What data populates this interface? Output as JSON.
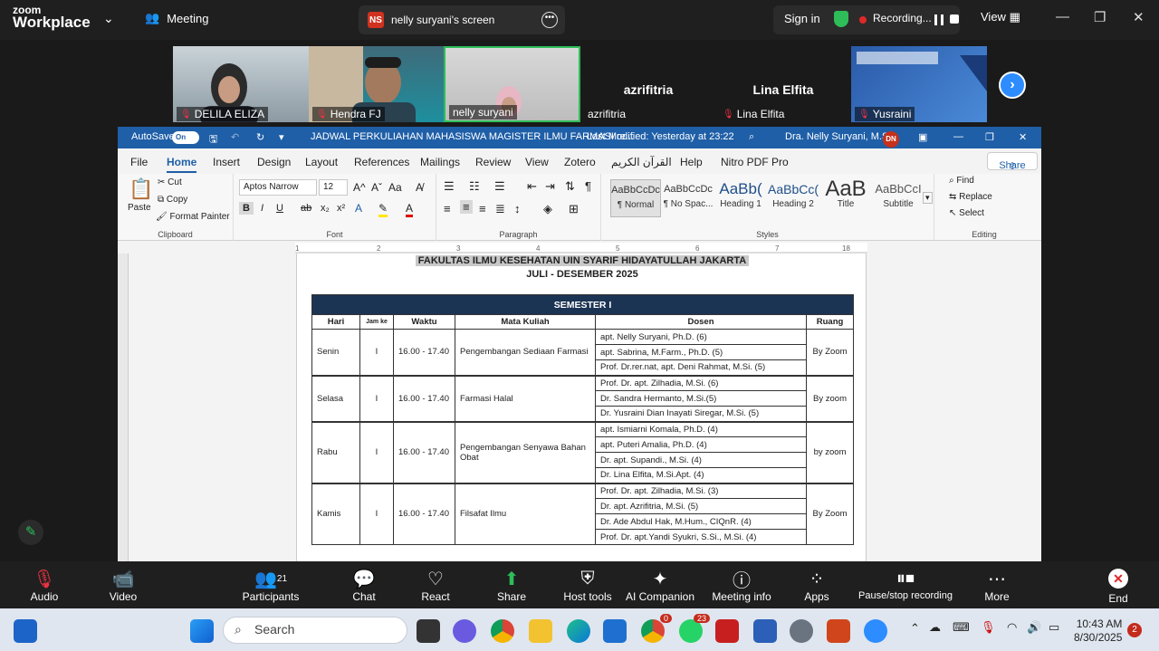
{
  "topbar": {
    "logo_small": "zoom",
    "logo_big": "Workplace",
    "meeting_label": "Meeting",
    "screen_badge": "NS",
    "screen_label": "nelly suryani's screen",
    "signin": "Sign in",
    "recording": "Recording...",
    "view": "View"
  },
  "thumbnails": [
    {
      "name": "DELILA ELIZA"
    },
    {
      "name": "Hendra FJ"
    },
    {
      "name": "nelly suryani"
    },
    {
      "name": "azrifitria",
      "big": "azrifitria"
    },
    {
      "name": "Lina Elfita",
      "big": "Lina Elfita"
    },
    {
      "name": "Yusraini"
    }
  ],
  "word": {
    "autosave": "AutoSave",
    "autosave_state": "On",
    "doc_title": "JADWAL PERKULIAHAN MAHASISWA MAGISTER ILMU FARMASI re...",
    "modified": "Last Modified: Yesterday at 23:22",
    "user": "Dra. Nelly Suryani, M.Si.",
    "avatar": "DN",
    "tabs": [
      "File",
      "Home",
      "Insert",
      "Design",
      "Layout",
      "References",
      "Mailings",
      "Review",
      "View",
      "Zotero",
      "القرآن الكريم",
      "Help",
      "Nitro PDF Pro"
    ],
    "share": "Share",
    "clipboard": {
      "paste": "Paste",
      "cut": "Cut",
      "copy": "Copy",
      "painter": "Format Painter",
      "label": "Clipboard"
    },
    "font": {
      "name": "Aptos Narrow",
      "size": "12",
      "label": "Font"
    },
    "paragraph_label": "Paragraph",
    "styles": [
      {
        "preview": "AaBbCcDc",
        "label": "¶ Normal"
      },
      {
        "preview": "AaBbCcDc",
        "label": "¶ No Spac..."
      },
      {
        "preview": "AaBb(",
        "label": "Heading 1"
      },
      {
        "preview": "AaBbCc(",
        "label": "Heading 2"
      },
      {
        "preview": "AaB",
        "label": "Title"
      },
      {
        "preview": "AaBbCcI",
        "label": "Subtitle"
      }
    ],
    "styles_label": "Styles",
    "editing": {
      "find": "Find",
      "replace": "Replace",
      "select": "Select",
      "label": "Editing"
    }
  },
  "document": {
    "header1": "FAKULTAS ILMU KESEHATAN UIN SYARIF HIDAYATULLAH JAKARTA",
    "header2": "JULI - DESEMBER  2025",
    "semester": "SEMESTER I",
    "columns": [
      "Hari",
      "Jam ke",
      "Waktu",
      "Mata Kuliah",
      "Dosen",
      "Ruang"
    ],
    "rows": [
      {
        "hari": "Senin",
        "jam": "I",
        "waktu": "16.00 - 17.40",
        "mk": "Pengembangan Sediaan Farmasi",
        "ruang": "By Zoom",
        "dosen": [
          "apt. Nelly Suryani, Ph.D. (6)",
          "apt. Sabrina, M.Farm., Ph.D. (5)",
          "Prof. Dr.rer.nat, apt. Deni Rahmat, M.Si. (5)"
        ]
      },
      {
        "hari": "Selasa",
        "jam": "I",
        "waktu": "16.00 - 17.40",
        "mk": "Farmasi Halal",
        "ruang": "By zoom",
        "dosen": [
          "Prof. Dr. apt. Zilhadia, M.Si. (6)",
          "Dr. Sandra Hermanto, M.Si.(5)",
          "Dr. Yusraini Dian Inayati Siregar, M.Si. (5)"
        ]
      },
      {
        "hari": "Rabu",
        "jam": "I",
        "waktu": "16.00 - 17.40",
        "mk": "Pengembangan Senyawa Bahan Obat",
        "ruang": "by zoom",
        "dosen": [
          "apt. Ismiarni Komala, Ph.D. (4)",
          "apt. Puteri Amalia, Ph.D. (4)",
          "Dr. apt. Supandi., M.Si. (4)",
          "Dr. Lina Elfita, M.Si.Apt. (4)"
        ]
      },
      {
        "hari": "Kamis",
        "jam": "I",
        "waktu": "16.00 - 17.40",
        "mk": "Filsafat Ilmu",
        "ruang": "By Zoom",
        "dosen": [
          "Prof. Dr. apt. Zilhadia, M.Si. (3)",
          "Dr. apt. Azrifitria, M.Si. (5)",
          "Dr. Ade Abdul Hak, M.Hum., CIQnR. (4)",
          "Prof. Dr. apt.Yandi Syukri, S.Si., M.Si. (4)"
        ]
      }
    ]
  },
  "zoom_bar": {
    "audio": "Audio",
    "video": "Video",
    "participants": "Participants",
    "participants_count": "21",
    "chat": "Chat",
    "react": "React",
    "share": "Share",
    "host_tools": "Host tools",
    "ai": "AI Companion",
    "meeting_info": "Meeting info",
    "apps": "Apps",
    "pause_rec": "Pause/stop recording",
    "more": "More",
    "end": "End"
  },
  "taskbar": {
    "search": "Search",
    "time": "10:43 AM",
    "date": "8/30/2025",
    "notifications": "2",
    "chrome_badge": "0",
    "whatsapp_badge": "23"
  }
}
